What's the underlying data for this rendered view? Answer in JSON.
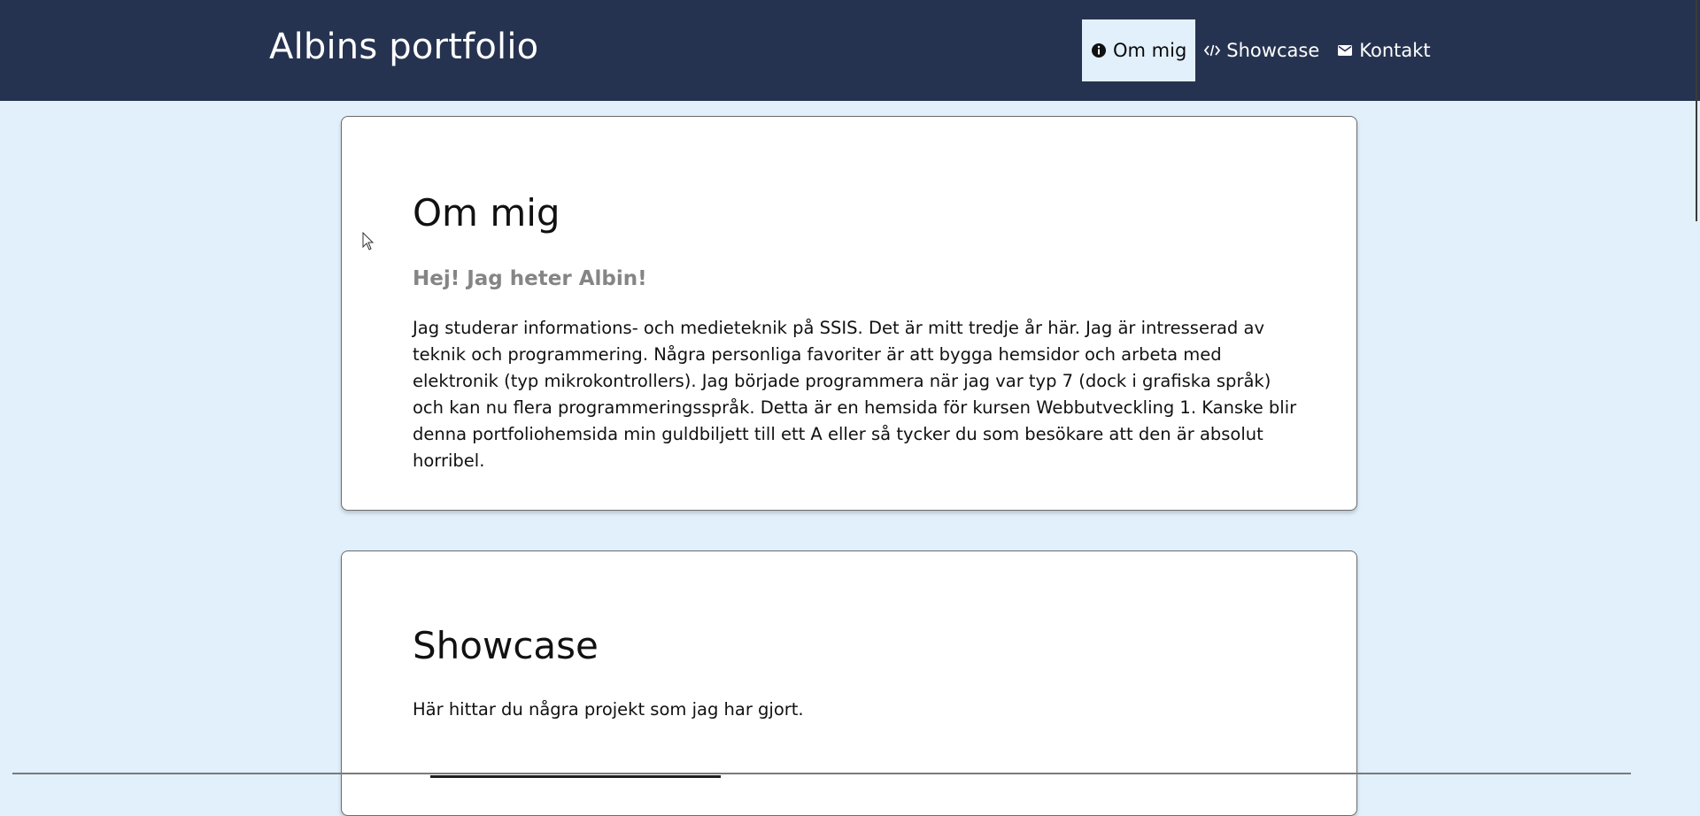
{
  "header": {
    "brand": "Albins portfolio",
    "nav": [
      {
        "label": "Om mig",
        "icon": "info-icon",
        "active": true
      },
      {
        "label": "Showcase",
        "icon": "code-icon",
        "active": false
      },
      {
        "label": "Kontakt",
        "icon": "mail-icon",
        "active": false
      }
    ]
  },
  "about": {
    "title": "Om mig",
    "subtitle": "Hej! Jag heter Albin!",
    "paragraph": "Jag studerar informations- och medieteknik på SSIS. Det är mitt tredje år här. Jag är intresserad av teknik och programmering. Några personliga favoriter är att bygga hemsidor och arbeta med elektronik (typ mikrokontrollers). Jag började programmera när jag var typ 7 (dock i grafiska språk) och kan nu flera programmeringsspråk. Detta är en hemsida för kursen Webbutveckling 1. Kanske blir denna portfoliohemsida min guldbiljett till ett A eller så tycker du som besökare att den är absolut horribel."
  },
  "showcase": {
    "title": "Showcase",
    "paragraph": "Här hittar du några projekt som jag har gjort."
  },
  "colors": {
    "header_bg": "#263350",
    "page_bg": "#e2f0fc",
    "active_nav_bg": "#e2f0fc",
    "subtitle": "#858585"
  }
}
